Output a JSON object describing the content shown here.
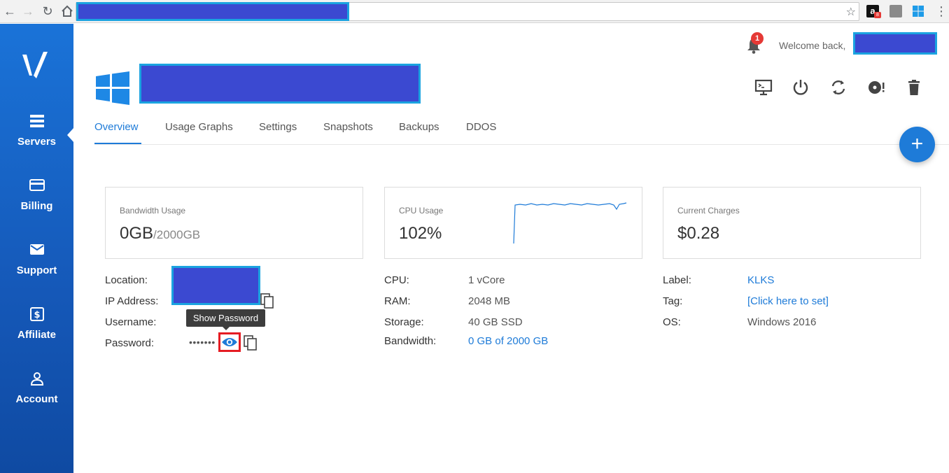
{
  "sidebar": {
    "items": [
      {
        "label": "Servers",
        "icon": "server-icon",
        "active": true
      },
      {
        "label": "Billing",
        "icon": "credit-card-icon"
      },
      {
        "label": "Support",
        "icon": "envelope-icon"
      },
      {
        "label": "Affiliate",
        "icon": "dollar-icon"
      },
      {
        "label": "Account",
        "icon": "person-icon"
      }
    ]
  },
  "header": {
    "notification_count": "1",
    "welcome": "Welcome back,"
  },
  "tabs": [
    "Overview",
    "Usage Graphs",
    "Settings",
    "Snapshots",
    "Backups",
    "DDOS"
  ],
  "fab": {
    "label": "+"
  },
  "cards": {
    "bandwidth": {
      "title": "Bandwidth Usage",
      "value": "0GB",
      "sub": "/2000GB"
    },
    "cpu": {
      "title": "CPU Usage",
      "value": "102%"
    },
    "charges": {
      "title": "Current Charges",
      "value": "$0.28"
    }
  },
  "details_left": {
    "location_label": "Location:",
    "ip_label": "IP Address:",
    "username_label": "Username:",
    "password_label": "Password:",
    "password_mask": "•••••••",
    "tooltip": "Show Password"
  },
  "details_mid": {
    "cpu_label": "CPU:",
    "cpu_value": "1 vCore",
    "ram_label": "RAM:",
    "ram_value": "2048 MB",
    "storage_label": "Storage:",
    "storage_value": "40 GB SSD",
    "bandwidth_label": "Bandwidth:",
    "bandwidth_value": "0 GB of 2000 GB"
  },
  "details_right": {
    "label_label": "Label:",
    "label_value": "KLKS",
    "tag_label": "Tag:",
    "tag_value": "[Click here to set]",
    "os_label": "OS:",
    "os_value": "Windows 2016"
  },
  "colors": {
    "accent": "#1e7bd8",
    "sidebar": "#1a73d8",
    "redaction": "#3b49d1",
    "highlight": "#e51c23"
  }
}
